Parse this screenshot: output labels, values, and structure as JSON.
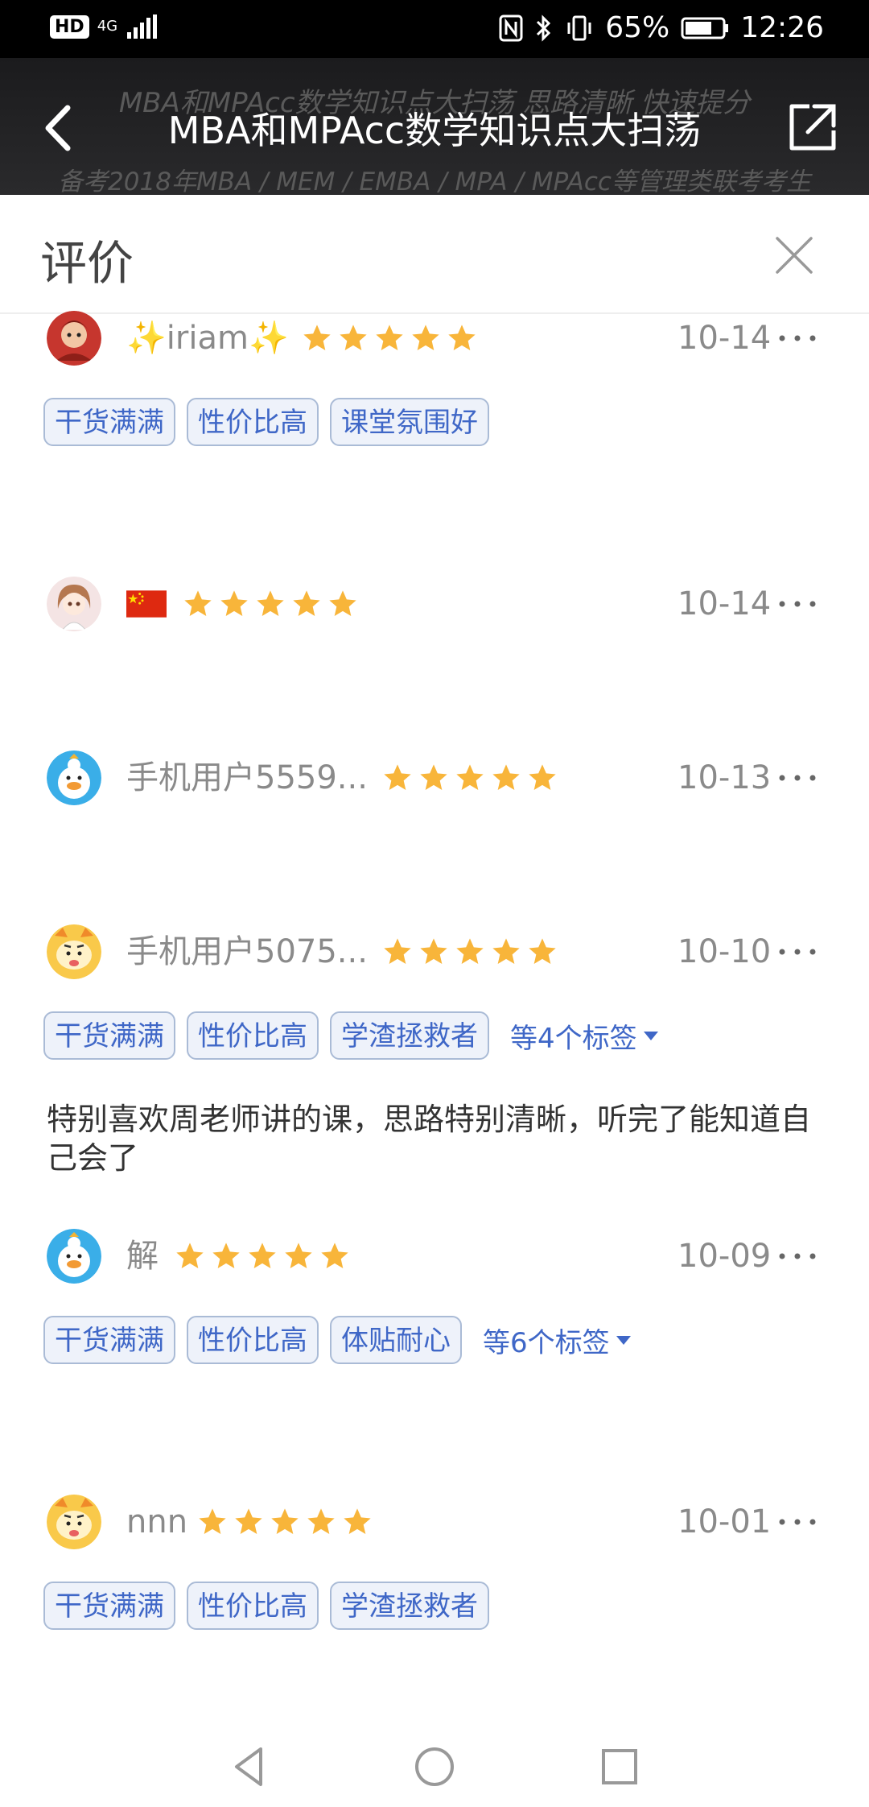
{
  "status_bar": {
    "hd": "HD",
    "network": "4G",
    "battery": "65%",
    "time": "12:26"
  },
  "nav": {
    "title": "MBA和MPAcc数学知识点大扫荡",
    "ghost_line1": "MBA和MPAcc数学知识点大扫荡 思路清晰 快速提分",
    "ghost_line2": "备考2018年MBA / MEM / EMBA / MPA / MPAcc等管理类联考考生"
  },
  "sheet": {
    "title": "评价"
  },
  "colors": {
    "star": "#f8b53a",
    "tag_text": "#3f67c7",
    "tag_border": "#aabbd6",
    "tag_bg": "#eef2fa"
  },
  "reviews": [
    {
      "name": "✨iriam✨",
      "rating": 5,
      "date": "10-14",
      "tags": [
        "干货满满",
        "性价比高",
        "课堂氛围好"
      ],
      "more_tags": "",
      "comment": "",
      "avatar": "red-character"
    },
    {
      "name": "🇨🇳",
      "rating": 5,
      "date": "10-14",
      "tags": [],
      "more_tags": "",
      "comment": "",
      "avatar": "anime-girl"
    },
    {
      "name": "手机用户5559...",
      "rating": 5,
      "date": "10-13",
      "tags": [],
      "more_tags": "",
      "comment": "",
      "avatar": "blue-duck"
    },
    {
      "name": "手机用户5075...",
      "rating": 5,
      "date": "10-10",
      "tags": [
        "干货满满",
        "性价比高",
        "学渣拯救者"
      ],
      "more_tags": "等4个标签",
      "comment": "特别喜欢周老师讲的课，思路特别清晰，听完了能知道自己会了",
      "avatar": "yellow-tiger"
    },
    {
      "name": "解",
      "rating": 5,
      "date": "10-09",
      "tags": [
        "干货满满",
        "性价比高",
        "体贴耐心"
      ],
      "more_tags": "等6个标签",
      "comment": "",
      "avatar": "blue-duck"
    },
    {
      "name": "nnn",
      "rating": 5,
      "date": "10-01",
      "tags": [
        "干货满满",
        "性价比高",
        "学渣拯救者"
      ],
      "more_tags": "",
      "comment": "",
      "avatar": "yellow-tiger"
    }
  ]
}
